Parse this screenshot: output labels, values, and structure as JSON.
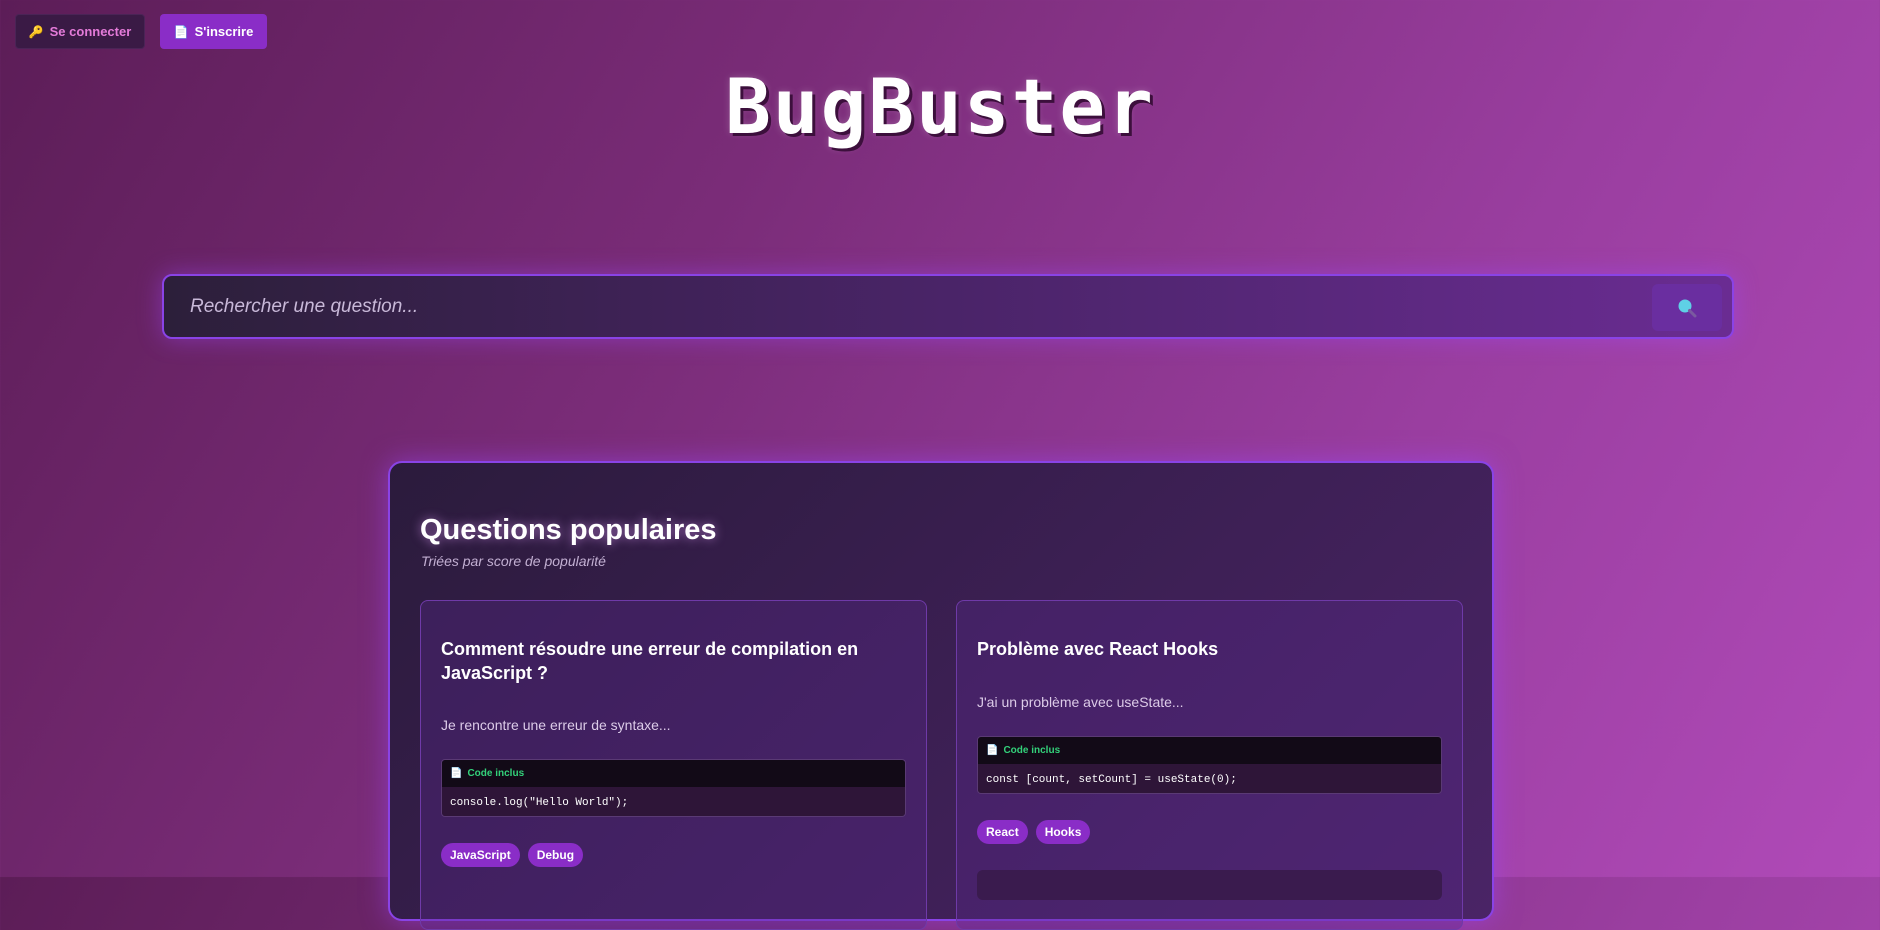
{
  "header": {
    "login_label": "Se connecter",
    "signup_label": "S'inscrire",
    "logo": "BugBuster"
  },
  "search": {
    "placeholder": "Rechercher une question..."
  },
  "popular": {
    "title": "Questions populaires",
    "subtitle": "Triées par score de popularité",
    "questions": [
      {
        "title": "Comment résoudre une erreur de compilation en JavaScript ?",
        "excerpt": "Je rencontre une erreur de syntaxe...",
        "code_label": "Code inclus",
        "code": "console.log(\"Hello World\");",
        "tags": [
          "JavaScript",
          "Debug"
        ]
      },
      {
        "title": "Problème avec React Hooks",
        "excerpt": "J'ai un problème avec useState...",
        "code_label": "Code inclus",
        "code": "const [count, setCount] = useState(0);",
        "tags": [
          "React",
          "Hooks"
        ]
      }
    ]
  },
  "colors": {
    "accent": "#8a2dc7",
    "border": "#8a43e6",
    "code_label": "#33d17a"
  },
  "icons": {
    "login": "key-icon",
    "signup": "document-icon",
    "search": "magnifier-icon",
    "code": "document-icon"
  }
}
